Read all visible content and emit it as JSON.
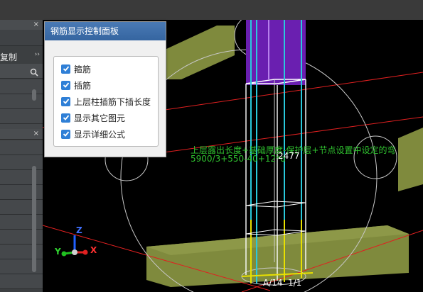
{
  "left_panel": {
    "copy_label": "复制",
    "close_glyph": "×",
    "expand_glyph": "››"
  },
  "control_panel": {
    "title": "钢筋显示控制面板",
    "options": [
      {
        "label": "箍筋",
        "checked": true
      },
      {
        "label": "插筋",
        "checked": true
      },
      {
        "label": "上层柱插筋下插长度",
        "checked": true
      },
      {
        "label": "显示其它图元",
        "checked": true
      },
      {
        "label": "显示详细公式",
        "checked": true
      }
    ]
  },
  "viewport": {
    "formula_line1": "上层露出长度+基础厚度-保护层+节点设置中设定的弯",
    "formula_line2": "5900/3+550-40+12*d",
    "dim_value": "2477",
    "bottom_label_left": "A/14",
    "bottom_label_right": "1/1",
    "axis_x": "X",
    "axis_y": "Y",
    "axis_z": "Z"
  },
  "colors": {
    "formula_green": "#2fc22f",
    "rebar_cyan": "#29c9dc",
    "rebar_yellow": "#e8e000",
    "slab_olive": "#7f8a3d",
    "column_purple": "#6a1fb0",
    "checkbox_blue": "#2f7fd6",
    "panel_title_blue": "#3565a0"
  },
  "icons": [
    "close-icon",
    "expand-icon",
    "search-icon",
    "checkmark-icon",
    "axis-gizmo-icon"
  ]
}
